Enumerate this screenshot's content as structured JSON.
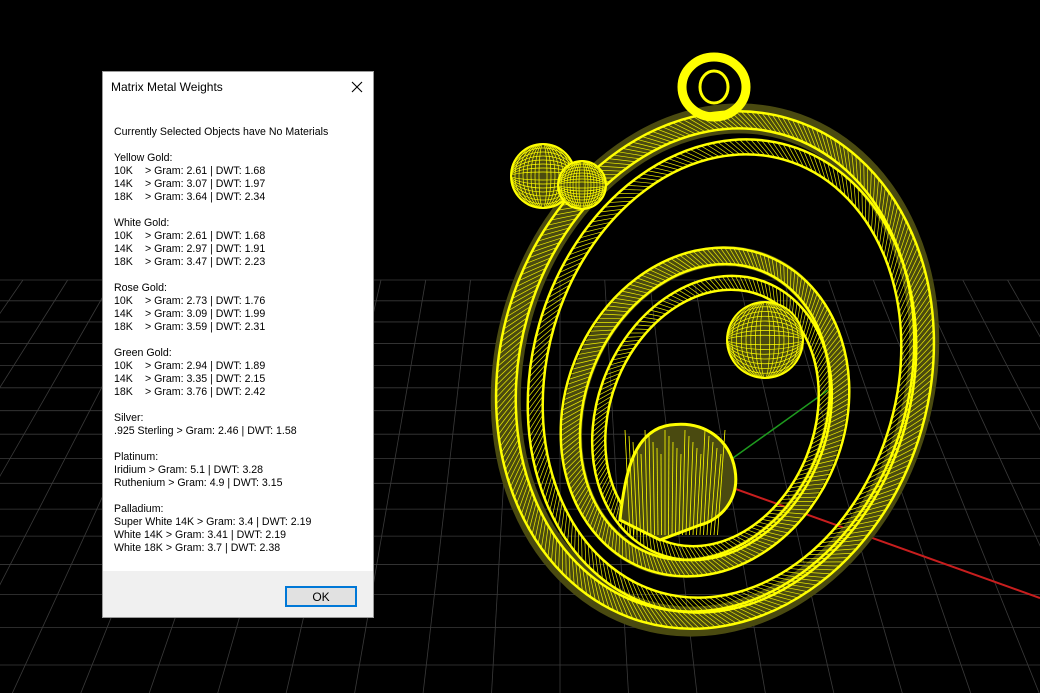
{
  "dialog": {
    "title": "Matrix Metal Weights",
    "close_icon": "close-icon",
    "status": "Currently Selected Objects have No Materials",
    "ok_label": "OK",
    "groups": [
      {
        "name": "Yellow Gold:",
        "rows": [
          {
            "label": "10K",
            "value": "> Gram: 2.61 | DWT: 1.68"
          },
          {
            "label": "14K",
            "value": "> Gram: 3.07 | DWT: 1.97"
          },
          {
            "label": "18K",
            "value": "> Gram: 3.64 | DWT: 2.34"
          }
        ]
      },
      {
        "name": "White Gold:",
        "rows": [
          {
            "label": "10K",
            "value": "> Gram: 2.61 | DWT: 1.68"
          },
          {
            "label": "14K",
            "value": "> Gram: 2.97 | DWT: 1.91"
          },
          {
            "label": "18K",
            "value": "> Gram: 3.47 | DWT: 2.23"
          }
        ]
      },
      {
        "name": "Rose Gold:",
        "rows": [
          {
            "label": "10K",
            "value": "> Gram: 2.73 | DWT: 1.76"
          },
          {
            "label": "14K",
            "value": "> Gram: 3.09 | DWT: 1.99"
          },
          {
            "label": "18K",
            "value": "> Gram: 3.59 | DWT: 2.31"
          }
        ]
      },
      {
        "name": "Green Gold:",
        "rows": [
          {
            "label": "10K",
            "value": "> Gram: 2.94 | DWT: 1.89"
          },
          {
            "label": "14K",
            "value": "> Gram: 3.35 | DWT: 2.15"
          },
          {
            "label": "18K",
            "value": "> Gram: 3.76 | DWT: 2.42"
          }
        ]
      },
      {
        "name": "Silver:",
        "rows": [
          {
            "label": ".925 Sterling",
            "value": "> Gram: 2.46 | DWT: 1.58"
          }
        ]
      },
      {
        "name": "Platinum:",
        "rows": [
          {
            "label": "Iridium",
            "value": "> Gram: 5.1 | DWT: 3.28"
          },
          {
            "label": "Ruthenium",
            "value": "> Gram: 4.9 | DWT: 3.15"
          }
        ]
      },
      {
        "name": "Palladium:",
        "rows": [
          {
            "label": "Super White 14K",
            "value": "> Gram: 3.4 | DWT: 2.19"
          },
          {
            "label": "White 14K",
            "value": "> Gram: 3.41 | DWT: 2.19"
          },
          {
            "label": "White 18K",
            "value": "> Gram: 3.7 | DWT: 2.38"
          }
        ]
      }
    ]
  },
  "viewport": {
    "background": "#000000",
    "grid_color": "#3a3a3a",
    "x_axis_color": "#c81e1e",
    "y_axis_color": "#1e9a1e",
    "model_color": "#ffff00",
    "model_shade": "#4a4a10",
    "model": "pendant-wireframe"
  }
}
